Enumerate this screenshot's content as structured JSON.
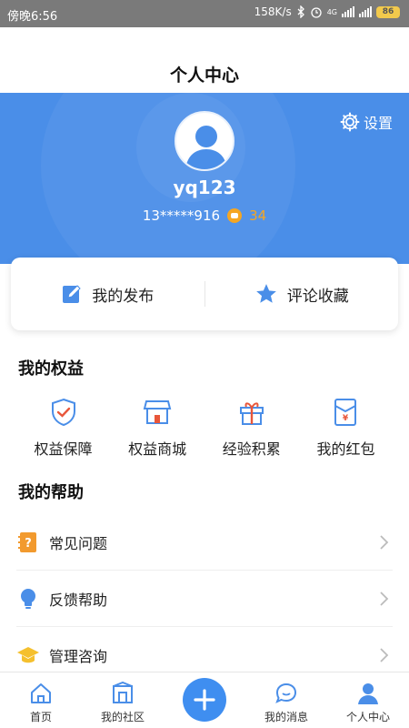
{
  "status_bar": {
    "time": "傍晚6:56",
    "speed": "158K/s",
    "network": "4G",
    "battery": "86"
  },
  "header": {
    "title": "个人中心"
  },
  "profile": {
    "settings_label": "设置",
    "username": "yq123",
    "phone": "13*****916",
    "points": "34"
  },
  "quick_actions": {
    "publish_label": "我的发布",
    "favorites_label": "评论收藏"
  },
  "benefits": {
    "title": "我的权益",
    "items": [
      {
        "label": "权益保障"
      },
      {
        "label": "权益商城"
      },
      {
        "label": "经验积累"
      },
      {
        "label": "我的红包"
      }
    ]
  },
  "help": {
    "title": "我的帮助",
    "items": [
      {
        "label": "常见问题"
      },
      {
        "label": "反馈帮助"
      },
      {
        "label": "管理咨询"
      }
    ]
  },
  "tabbar": {
    "items": [
      {
        "label": "首页"
      },
      {
        "label": "我的社区"
      },
      {
        "label": ""
      },
      {
        "label": "我的消息"
      },
      {
        "label": "个人中心"
      }
    ]
  },
  "colors": {
    "primary": "#4a8ee8",
    "accent_orange": "#f5a623",
    "text": "#222222"
  }
}
